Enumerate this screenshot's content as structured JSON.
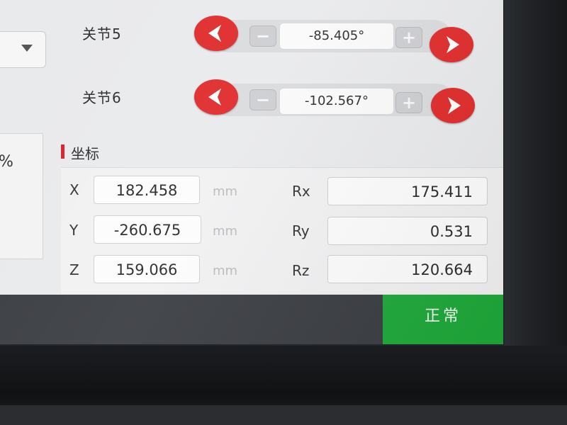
{
  "left_panel": {
    "percent_symbol": "%"
  },
  "joints": [
    {
      "label": "关节5",
      "value": "-85.405°",
      "decrement_symbol": "−",
      "increment_symbol": "+"
    },
    {
      "label": "关节6",
      "value": "-102.567°",
      "decrement_symbol": "−",
      "increment_symbol": "+"
    }
  ],
  "coordinates": {
    "title": "坐标",
    "rows": [
      {
        "axis": "X",
        "value": "182.458",
        "unit": "mm",
        "rot_axis": "Rx",
        "rot_value": "175.411"
      },
      {
        "axis": "Y",
        "value": "-260.675",
        "unit": "mm",
        "rot_axis": "Ry",
        "rot_value": "0.531"
      },
      {
        "axis": "Z",
        "value": "159.066",
        "unit": "mm",
        "rot_axis": "Rz",
        "rot_value": "120.664"
      }
    ]
  },
  "status": {
    "text": "正常",
    "color": "#1fa83a"
  },
  "colors": {
    "accent_red": "#e02b2b",
    "section_marker": "#d8232a"
  },
  "icons": {
    "decrease": "chevron-left-icon",
    "increase": "chevron-right-icon",
    "dropdown": "chevron-down-icon"
  }
}
